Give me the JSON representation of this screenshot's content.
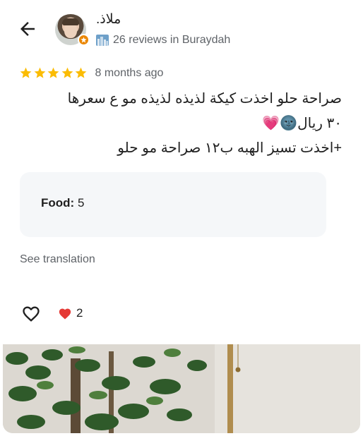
{
  "reviewer": {
    "name": "ملاذ.",
    "reviews_summary": "26 reviews in Buraydah",
    "badge_icon": "local-guide-badge-icon",
    "city_icon": "city-skyline-icon"
  },
  "review": {
    "rating": 5,
    "max_rating": 5,
    "date": "8 months ago",
    "lines": [
      "صراحة حلو اخذت كيكة لذيذه لذيذه مو ع سعرها",
      "٣٠ ريال🌚💗",
      "+اخذت تسيز الهبه ب١٢ صراحة مو حلو"
    ]
  },
  "ratings_card": {
    "label": "Food:",
    "value": "5"
  },
  "actions": {
    "see_translation": "See translation",
    "like_icon": "heart-outline-icon",
    "reaction_icon": "red-heart-icon",
    "reaction_count": "2"
  },
  "colors": {
    "star": "#fbbc04",
    "badge": "#ea8600",
    "card_bg": "#f5f7f9",
    "muted_text": "#5f6368"
  }
}
